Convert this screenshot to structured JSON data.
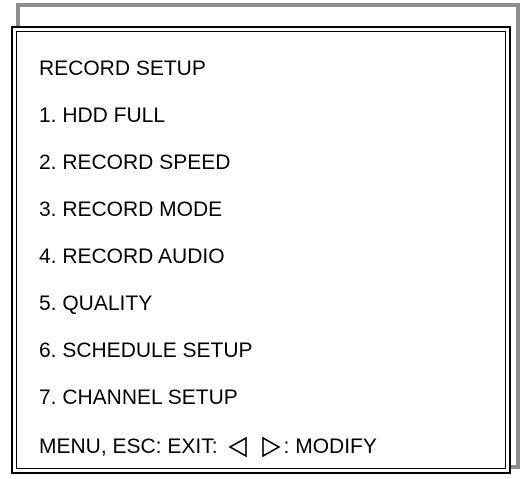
{
  "menu": {
    "title": "RECORD SETUP",
    "items": [
      {
        "label": "1. HDD FULL"
      },
      {
        "label": "2. RECORD SPEED"
      },
      {
        "label": "3. RECORD MODE"
      },
      {
        "label": "4. RECORD AUDIO"
      },
      {
        "label": "5. QUALITY"
      },
      {
        "label": "6. SCHEDULE SETUP"
      },
      {
        "label": "7. CHANNEL SETUP"
      }
    ]
  },
  "footer": {
    "exit_text": "MENU, ESC: EXIT:",
    "left_icon": "left-triangle-outline",
    "right_icon": "right-triangle-outline",
    "modify_text": ": MODIFY"
  },
  "colors": {
    "border": "#000000",
    "shadow": "#8c8c8c",
    "background": "#ffffff",
    "text": "#000000"
  }
}
